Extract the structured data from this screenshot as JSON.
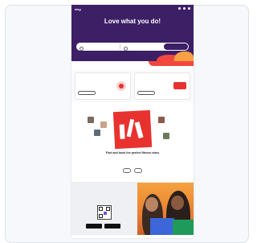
{
  "hero": {
    "logo": "etsy",
    "title": "Love what you do!",
    "subtitle": "",
    "link": "",
    "search": {
      "where_placeholder": "",
      "what_placeholder": ""
    },
    "colors": {
      "background": "#3d1f66",
      "accent": "#f0483e"
    }
  },
  "promos": [
    {
      "title": "",
      "desc": "",
      "button": ""
    },
    {
      "title": "",
      "desc": "",
      "button": ""
    }
  ],
  "feature": {
    "title": "Find and book the perfect fitness class",
    "desc": "",
    "buttons": [
      "",
      ""
    ],
    "collage_color": "#e8322f"
  },
  "app_section": {
    "title": "",
    "desc": "",
    "store_icons": [
      "app-store-badge",
      "google-play-badge"
    ]
  },
  "footer": {
    "text": ""
  }
}
